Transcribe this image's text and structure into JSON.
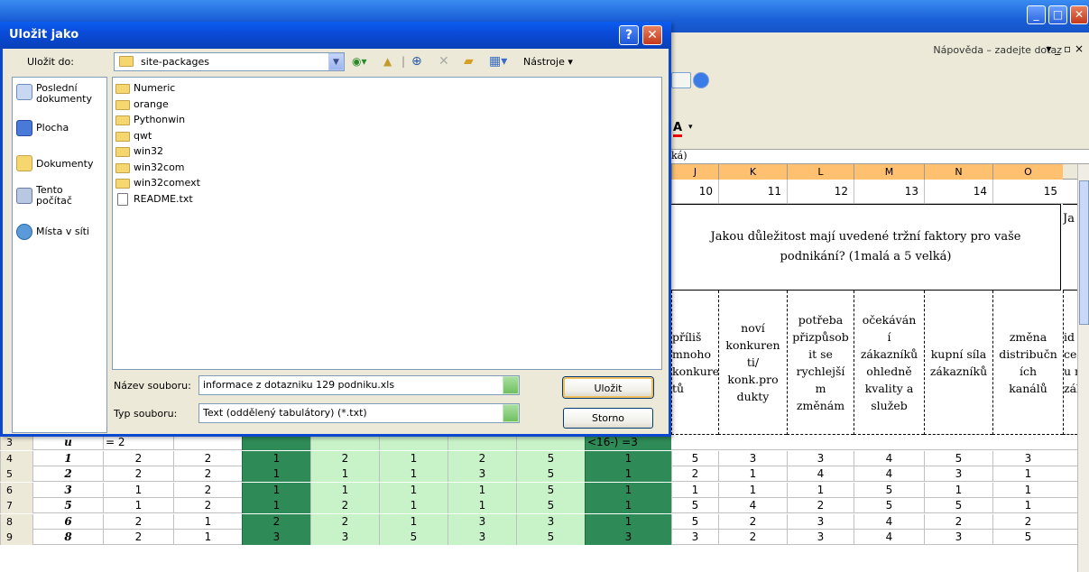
{
  "dialog": {
    "title": "Uložit jako",
    "help_button": "?",
    "close_button": "✕",
    "save_in_label": "Uložit do:",
    "save_in_value": "site-packages",
    "tools_label": "Nástroje ▾",
    "places": [
      "Poslední\ndokumenty",
      "Plocha",
      "Dokumenty",
      "Tento\npočítač",
      "Místa v síti"
    ],
    "files": [
      {
        "name": "Numeric",
        "type": "folder"
      },
      {
        "name": "orange",
        "type": "folder"
      },
      {
        "name": "Pythonwin",
        "type": "folder"
      },
      {
        "name": "qwt",
        "type": "folder"
      },
      {
        "name": "win32",
        "type": "folder"
      },
      {
        "name": "win32com",
        "type": "folder"
      },
      {
        "name": "win32comext",
        "type": "folder"
      },
      {
        "name": "README.txt",
        "type": "file"
      }
    ],
    "file_name_label": "Název souboru:",
    "file_name_value": "informace z dotazniku 129 podniku.xls",
    "file_type_label": "Typ souboru:",
    "file_type_value": "Text (oddělený tabulátory) (*.txt)",
    "save_button": "Uložit",
    "cancel_button": "Storno"
  },
  "excel": {
    "help_text": "Nápověda – zadejte dotaz",
    "formula_text": "ká)",
    "columns": [
      "J",
      "K",
      "L",
      "M",
      "N",
      "O"
    ],
    "row1_values": [
      "10",
      "11",
      "12",
      "13",
      "14",
      "15"
    ],
    "question": "Jakou důležitost mají uvedené tržní faktory pro vaše podnikání? (1malá a 5 velká)",
    "question_next": "Ja",
    "subheaders": [
      "příliš\nmnoho\nkonkuren\ntů",
      "noví\nkonkuren\nti/\nkonk.pro\ndukty",
      "potřeba\npřizpůsob\nit se\nrychlejší\nm\nzměnám",
      "očekáván\ní\nzákazníků\nohledně\nkvality a\nslužeb",
      "kupní síla\nzákazníků",
      "změna\ndistribučn\ních\nkanálů",
      "id\nce\nu r\nzál"
    ],
    "row3": {
      "rownum": "3",
      "id": "u",
      "b": "= 2",
      "i": "<16-) =3"
    },
    "rows": [
      {
        "rownum": "4",
        "id": "1",
        "v": [
          "2",
          "2",
          "1",
          "2",
          "1",
          "2",
          "5",
          "1",
          "5",
          "3",
          "3",
          "4",
          "5",
          "3"
        ]
      },
      {
        "rownum": "5",
        "id": "2",
        "v": [
          "2",
          "2",
          "1",
          "1",
          "1",
          "3",
          "5",
          "1",
          "2",
          "1",
          "4",
          "4",
          "3",
          "1"
        ]
      },
      {
        "rownum": "6",
        "id": "3",
        "v": [
          "1",
          "2",
          "1",
          "1",
          "1",
          "1",
          "5",
          "1",
          "1",
          "1",
          "1",
          "5",
          "1",
          "1"
        ]
      },
      {
        "rownum": "7",
        "id": "5",
        "v": [
          "1",
          "2",
          "1",
          "2",
          "1",
          "1",
          "5",
          "1",
          "5",
          "4",
          "2",
          "5",
          "5",
          "1"
        ]
      },
      {
        "rownum": "8",
        "id": "6",
        "v": [
          "2",
          "1",
          "2",
          "2",
          "1",
          "3",
          "3",
          "1",
          "5",
          "2",
          "3",
          "4",
          "2",
          "2"
        ]
      },
      {
        "rownum": "9",
        "id": "8",
        "v": [
          "2",
          "1",
          "3",
          "3",
          "5",
          "3",
          "5",
          "3",
          "3",
          "2",
          "3",
          "4",
          "3",
          "5"
        ]
      }
    ]
  }
}
